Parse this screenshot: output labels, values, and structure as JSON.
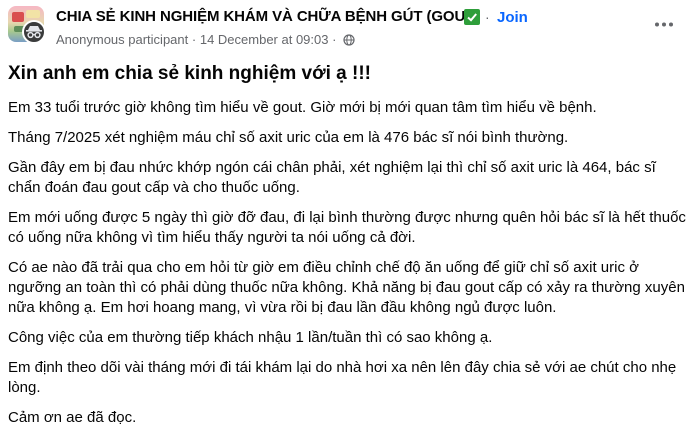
{
  "header": {
    "group_name": "CHIA SẺ KINH NGHIỆM KHÁM VÀ CHỮA BỆNH GÚT (GOUT)",
    "separator": "·",
    "join_label": "Join",
    "author": "Anonymous participant",
    "meta_separator": "·",
    "timestamp": "14 December at 09:03",
    "meta_separator2": "·",
    "privacy_icon": "globe-icon",
    "verified_icon": "check-badge-icon",
    "more_icon": "more-options-icon"
  },
  "post": {
    "title": "Xin anh em chia sẻ kinh nghiệm với ạ !!!",
    "paragraphs": [
      "Em 33 tuổi trước giờ không tìm hiểu về gout. Giờ mới bị mới quan tâm tìm hiểu về bệnh.",
      "Tháng 7/2025 xét nghiệm máu chỉ số axit uric của em là 476 bác sĩ nói bình thường.",
      "Gần đây em bị đau nhức khớp ngón cái chân phải, xét nghiệm lại thì chỉ số axit uric là 464, bác sĩ chẩn đoán đau gout cấp và cho thuốc uống.",
      "Em mới uống được 5 ngày thì giờ đỡ đau, đi lại bình thường được nhưng quên hỏi bác sĩ là hết thuốc có uống nữa không vì tìm hiểu thấy người ta nói uống cả đời.",
      "Có ae nào đã trải qua cho em hỏi từ giờ em điều chỉnh chế độ ăn uống để giữ chỉ số axit uric ở ngưỡng an toàn thì có phải dùng thuốc nữa không. Khả năng bị đau gout cấp có xảy ra thường xuyên nữa không ạ. Em hơi hoang mang, vì vừa rồi bị đau lần đầu không ngủ được luôn.",
      "Công việc của em thường tiếp khách nhậu 1 lần/tuần thì có sao không ạ.",
      "Em định theo dõi vài tháng mới đi tái khám lại do nhà hơi xa nên lên đây chia sẻ với ae chút cho nhẹ lòng.",
      "Cảm ơn ae đã đọc."
    ]
  },
  "colors": {
    "text": "#050505",
    "secondary": "#65676b",
    "link": "#0866ff",
    "verified": "#2e9e3a"
  }
}
